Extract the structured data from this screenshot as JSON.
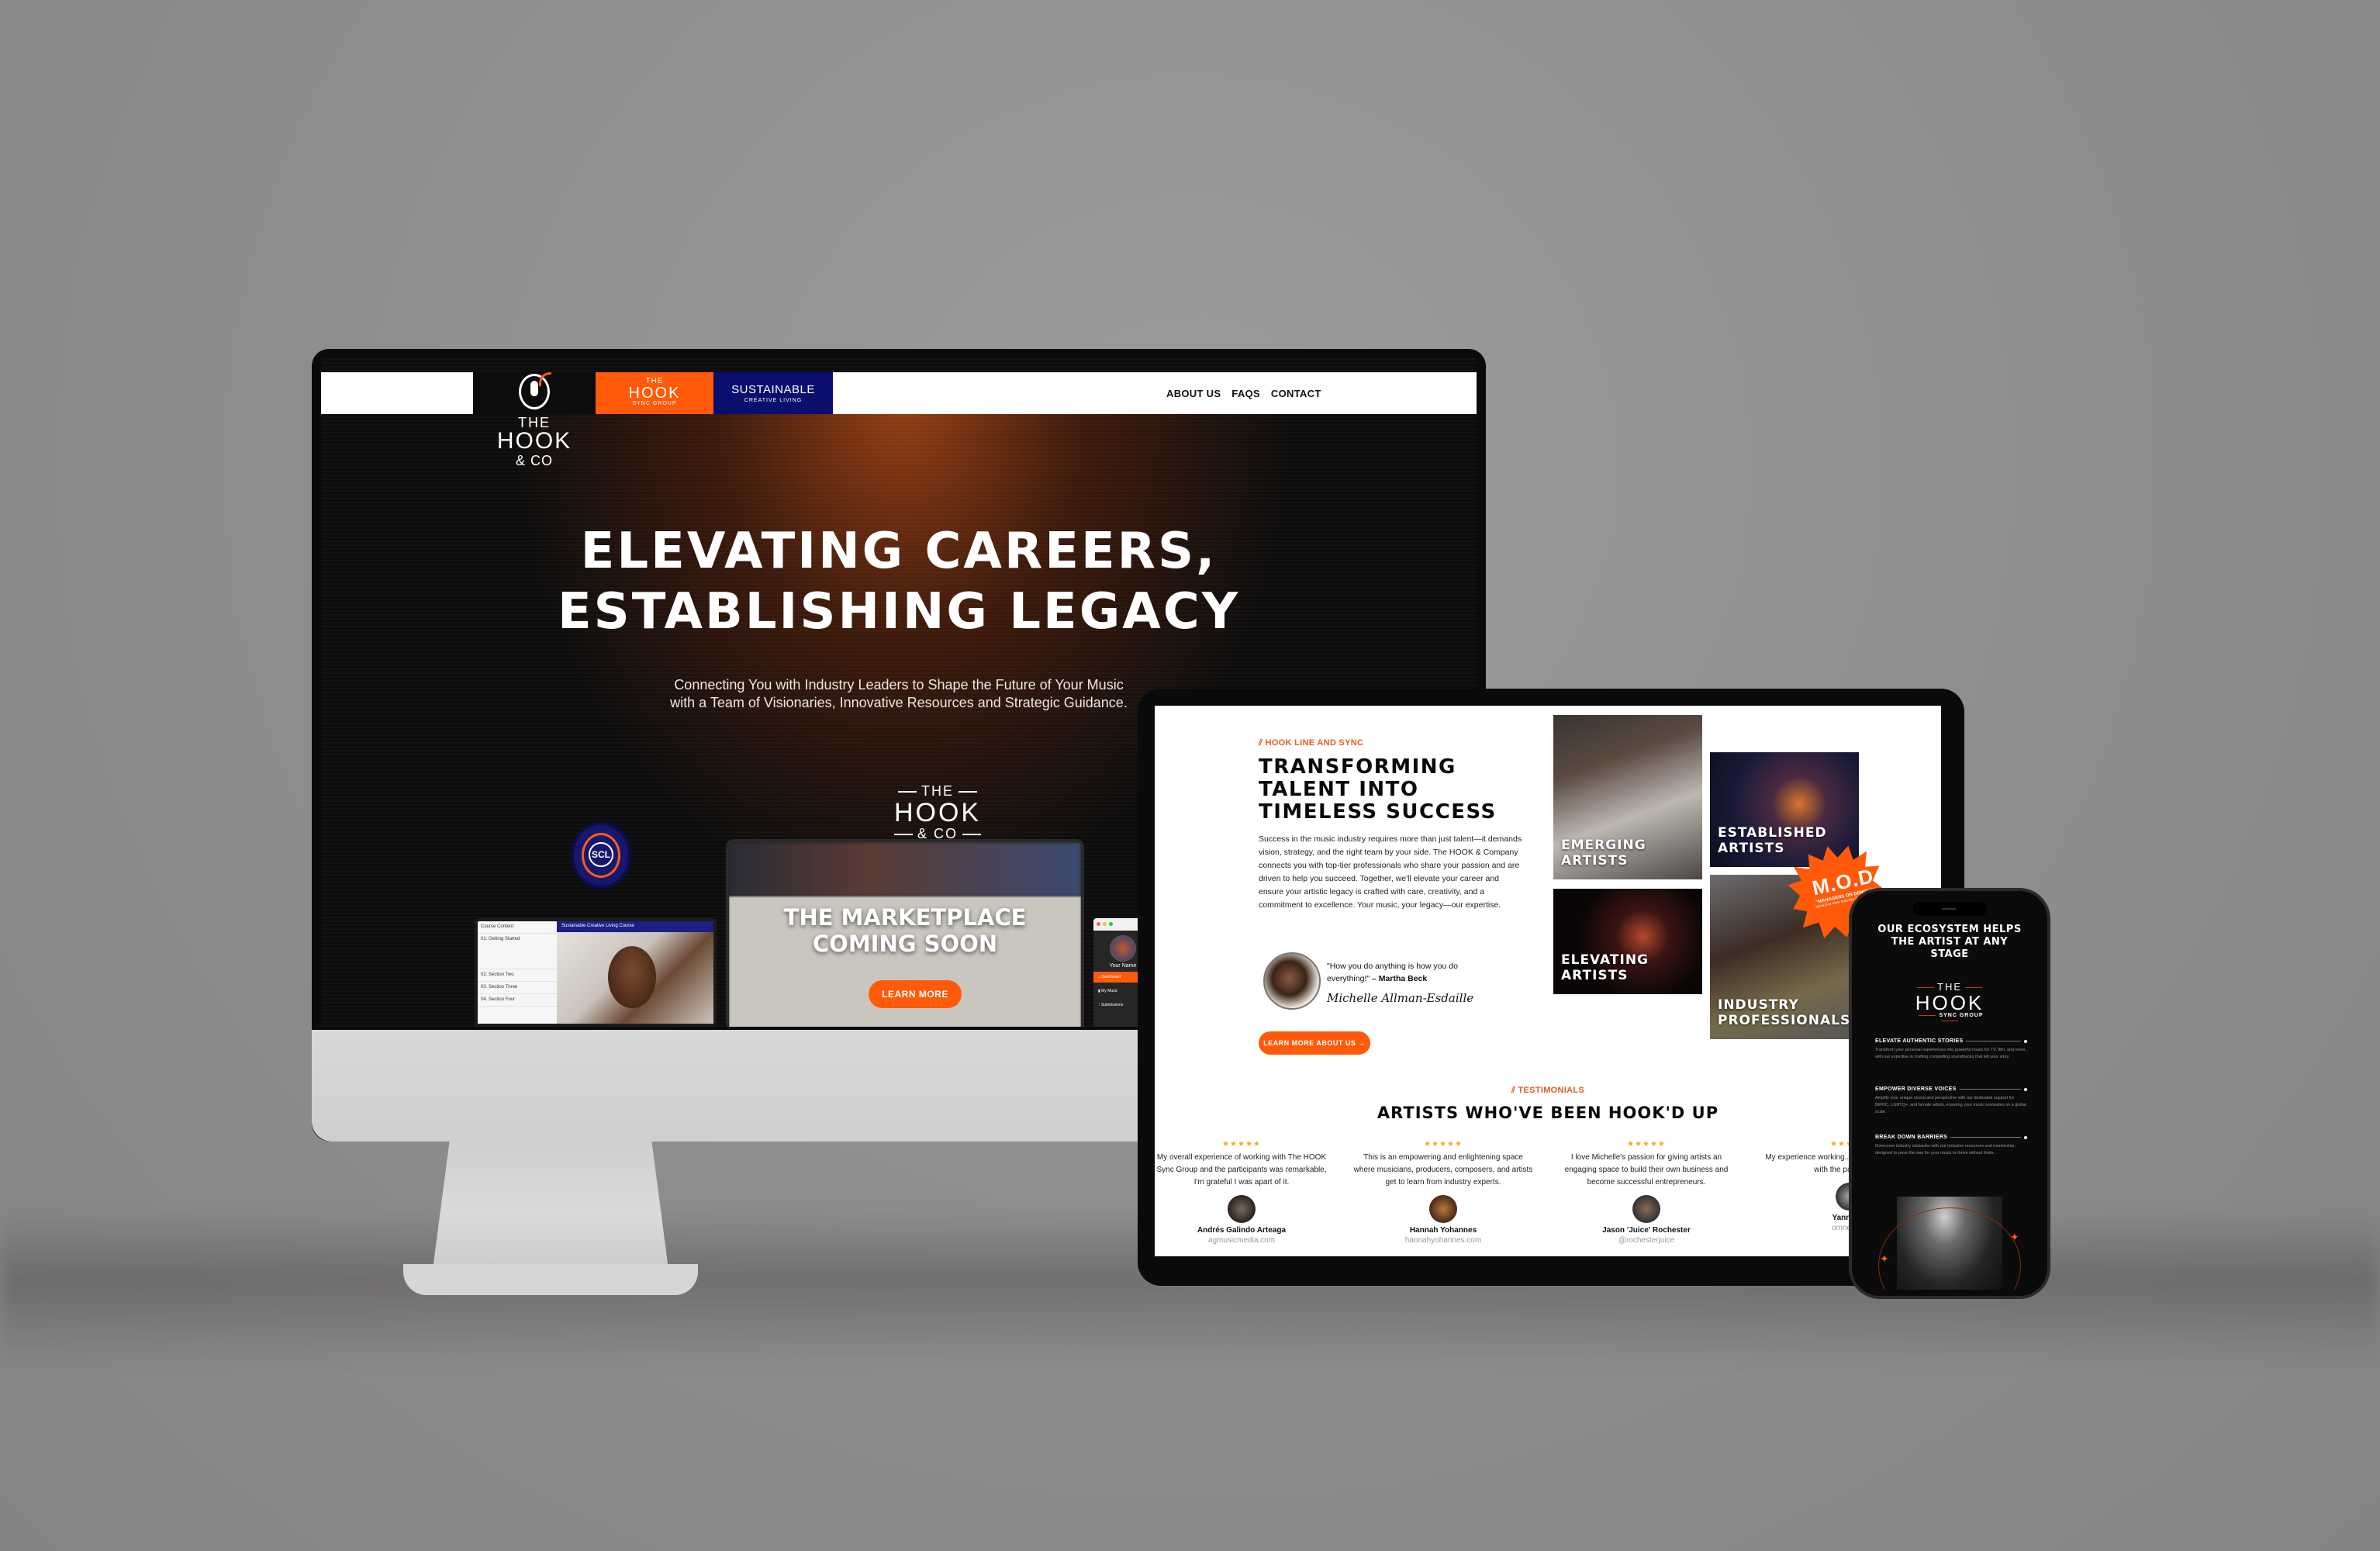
{
  "desktop": {
    "nav": {
      "links": [
        "ABOUT US",
        "FAQS",
        "CONTACT"
      ],
      "brand_hook": {
        "line1": "THE",
        "line2": "HOOK",
        "line3": "SYNC GROUP"
      },
      "brand_scl": {
        "line1": "SUSTAINABLE",
        "line2": "CREATIVE LIVING"
      }
    },
    "logo": {
      "line1": "THE",
      "line2": "HOOK",
      "line3": "& CO"
    },
    "hero": {
      "title_line1": "ELEVATING CAREERS,",
      "title_line2": "ESTABLISHING LEGACY",
      "subtitle": "Connecting You with Industry Leaders to Shape the Future of Your Music with a Team of Visionaries, Innovative Resources and Strategic Guidance."
    },
    "center_logo": {
      "line1": "THE",
      "line2": "HOOK",
      "line3": "& CO"
    },
    "scl_badge": "SCL",
    "course_preview": {
      "sidebar_title": "Course Content",
      "sections": [
        "01. Getting Started",
        "02. Section Two",
        "03. Section Three",
        "04. Section Four"
      ],
      "header": "Sustainable Creative Living Course"
    },
    "marketplace": {
      "title_line1": "THE MARKETPLACE",
      "title_line2": "COMING SOON",
      "button": "LEARN MORE"
    },
    "dashboard_preview": {
      "user": "Your Name",
      "items": [
        "Dashboard",
        "My Music",
        "Submissions"
      ]
    }
  },
  "tablet": {
    "intro": {
      "tag": "HOOK LINE AND SYNC",
      "title": "TRANSFORMING TALENT INTO TIMELESS SUCCESS",
      "body": "Success in the music industry requires more than just talent—it demands vision, strategy, and the right team by your side. The HOOK & Company connects you with top-tier professionals who share your passion and are driven to help you succeed. Together, we'll elevate your career and ensure your artistic legacy is crafted with care, creativity, and a commitment to excellence. Your music, your legacy—our expertise.",
      "quote": "\"How you do anything is how you do everything!\"",
      "quote_author": "– Martha Beck",
      "signature": "Michelle Allman-Esdaille",
      "button": "LEARN MORE ABOUT US →"
    },
    "cards": [
      {
        "label_line1": "EMERGING",
        "label_line2": "ARTISTS"
      },
      {
        "label_line1": "ESTABLISHED",
        "label_line2": "ARTISTS"
      },
      {
        "label_line1": "ELEVATING",
        "label_line2": "ARTISTS"
      },
      {
        "label_line1": "INDUSTRY",
        "label_line2": "PROFESSIONALS"
      }
    ],
    "mod_badge": {
      "title": "M.O.D",
      "subtitle": "\"MANAGERS ON DEMAND\"",
      "note": "Work-For-Hire Industry Professionals"
    },
    "testimonials": {
      "tag": "TESTIMONIALS",
      "title": "ARTISTS WHO'VE BEEN HOOK'D UP",
      "rating": 5,
      "items": [
        {
          "text": "My overall experience of working with The HOOK Sync Group and the participants was remarkable, I'm grateful I was apart of it.",
          "name": "Andrés Galindo Arteaga",
          "handle": "agmusicmedia.com"
        },
        {
          "text": "This is an empowering and enlightening space where musicians, producers, composers, and artists get to learn from industry experts.",
          "name": "Hannah Yohannes",
          "handle": "hannahyohannes.com"
        },
        {
          "text": "I love Michelle's passion for giving artists an engaging space to build their own business and become successful entrepreneurs.",
          "name": "Jason 'Juice' Rochester",
          "handle": "@rochesterjuice"
        },
        {
          "text": "My experience working... Music Production Acc... with the participant...",
          "name": "Yanni C...",
          "handle": "omnesia..."
        }
      ]
    }
  },
  "phone": {
    "title": "OUR ECOSYSTEM HELPS THE ARTIST AT ANY STAGE",
    "logo": {
      "line1": "THE",
      "line2": "HOOK",
      "line3": "SYNC GROUP"
    },
    "items": [
      {
        "head": "ELEVATE AUTHENTIC STORIES",
        "desc": "Transform your personal experiences into powerful music for TV, film, and more, with our expertise in crafting compelling soundtracks that tell your story."
      },
      {
        "head": "EMPOWER DIVERSE VOICES",
        "desc": "Amplify your unique sound and perspective with our dedicated support for BIPOC, LGBTQ+, and female artists, ensuring your music resonates on a global scale."
      },
      {
        "head": "BREAK DOWN BARRIERS",
        "desc": "Overcome industry obstacles with our inclusive resources and mentorship, designed to pave the way for your music to thrive without limits."
      }
    ]
  },
  "colors": {
    "accent_orange": "#ff5a0a",
    "brand_navy": "#0a0f6e",
    "star_gold": "#f5a623",
    "background_gray": "#8e8c8c"
  }
}
